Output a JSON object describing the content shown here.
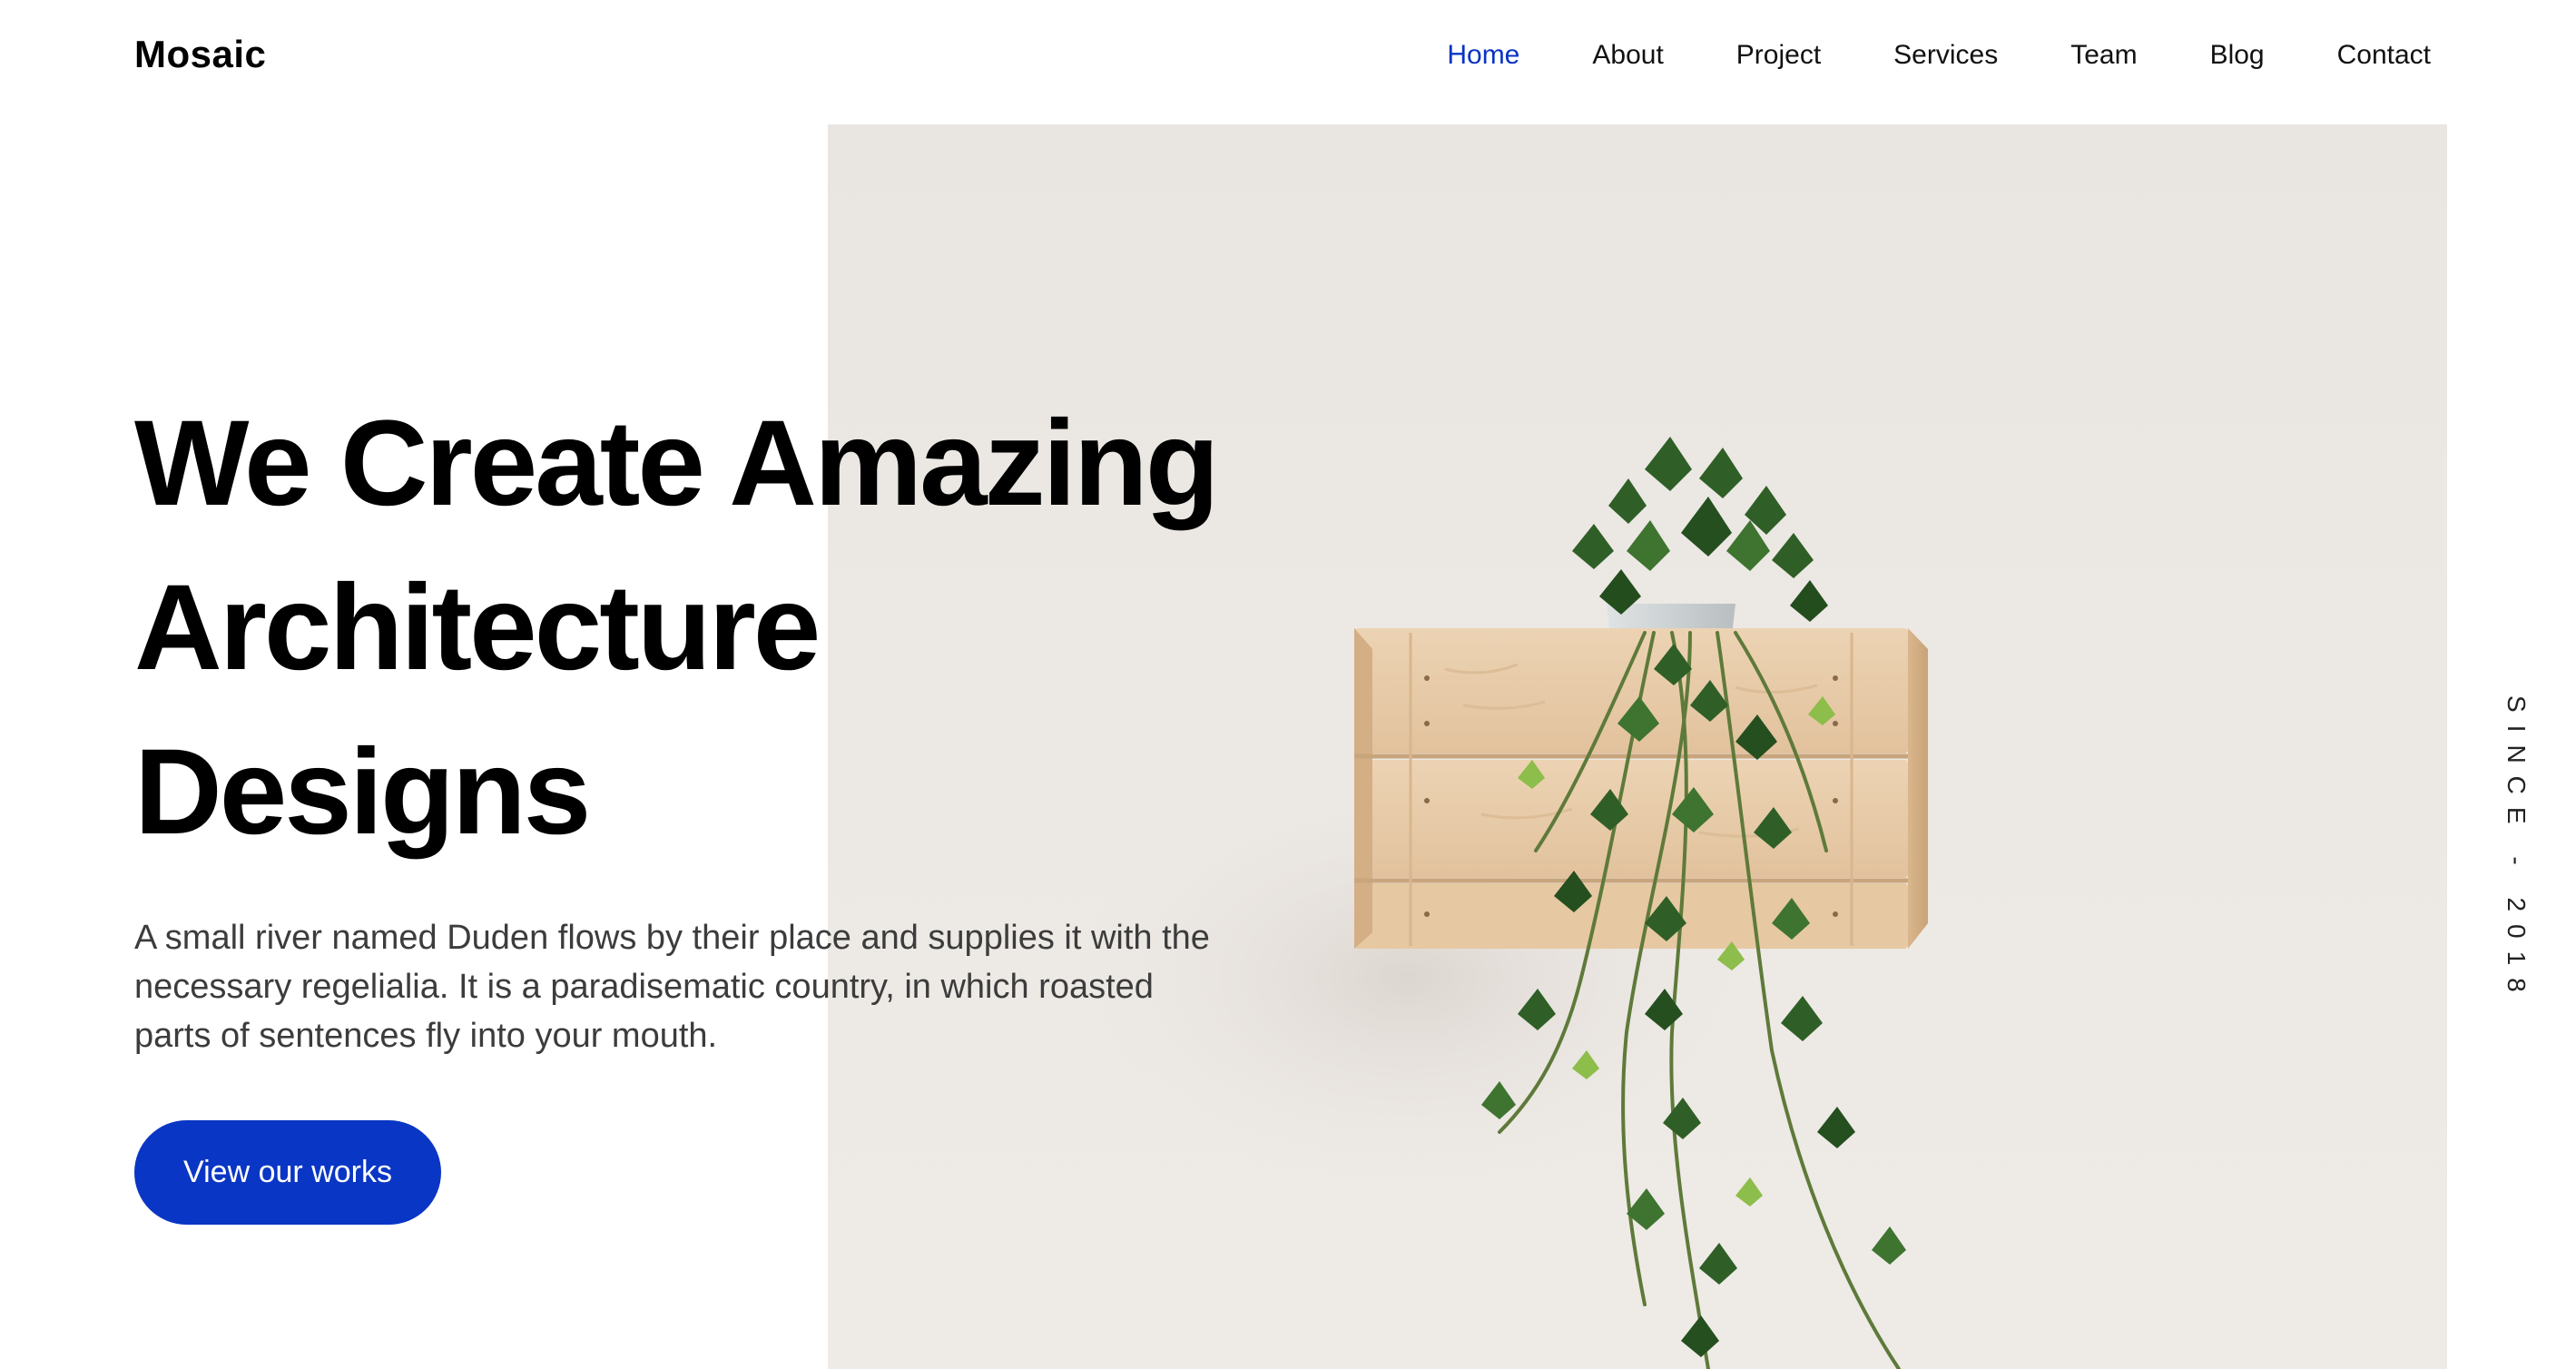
{
  "header": {
    "brand": "Mosaic",
    "nav": [
      {
        "label": "Home",
        "active": true
      },
      {
        "label": "About",
        "active": false
      },
      {
        "label": "Project",
        "active": false
      },
      {
        "label": "Services",
        "active": false
      },
      {
        "label": "Team",
        "active": false
      },
      {
        "label": "Blog",
        "active": false
      },
      {
        "label": "Contact",
        "active": false
      }
    ]
  },
  "hero": {
    "title_lines": [
      "We Create Amazing",
      "Architecture",
      "Designs"
    ],
    "text_lines": [
      "A small river named Duden flows by their place and supplies it with the",
      "necessary regelialia. It is a paradisematic country, in which roasted",
      "parts of sentences fly into your mouth."
    ],
    "cta_label": "View our works",
    "side_label": "SINCE - 2018",
    "image_subject": "potted-ivy-in-wooden-crate"
  },
  "colors": {
    "accent": "#0a33c2",
    "button": "#0a36c5",
    "text": "#000000",
    "body_text": "#3c3c3c",
    "photo_background": "#ece8e4"
  }
}
